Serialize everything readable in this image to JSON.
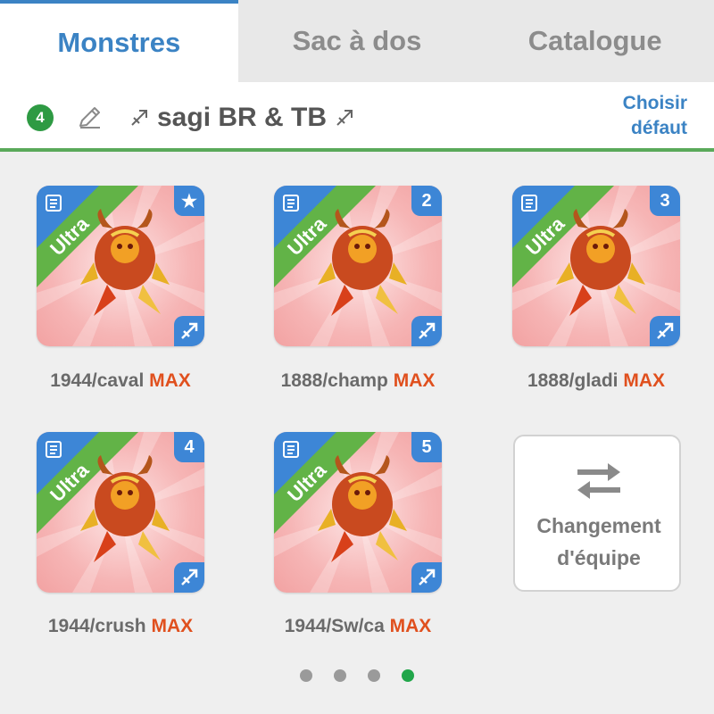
{
  "tabs": [
    {
      "label": "Monstres",
      "active": true
    },
    {
      "label": "Sac à dos",
      "active": false
    },
    {
      "label": "Catalogue",
      "active": false
    }
  ],
  "team": {
    "number": "4",
    "name": "sagi BR & TB",
    "choose_default": "Choisir défaut"
  },
  "monsters": [
    {
      "rarity": "Ultra",
      "slot": "★",
      "name": "1944/caval",
      "max": "MAX"
    },
    {
      "rarity": "Ultra",
      "slot": "2",
      "name": "1888/champ",
      "max": "MAX"
    },
    {
      "rarity": "Ultra",
      "slot": "3",
      "name": "1888/gladi",
      "max": "MAX"
    },
    {
      "rarity": "Ultra",
      "slot": "4",
      "name": "1944/crush",
      "max": "MAX"
    },
    {
      "rarity": "Ultra",
      "slot": "5",
      "name": "1944/Sw/ca",
      "max": "MAX"
    }
  ],
  "team_change": {
    "label": "Changement d'équipe"
  },
  "pager": {
    "pages": 4,
    "active_index": 3
  },
  "colors": {
    "accent": "#3b83c4",
    "green": "#2e9a43",
    "max": "#e0501e"
  }
}
